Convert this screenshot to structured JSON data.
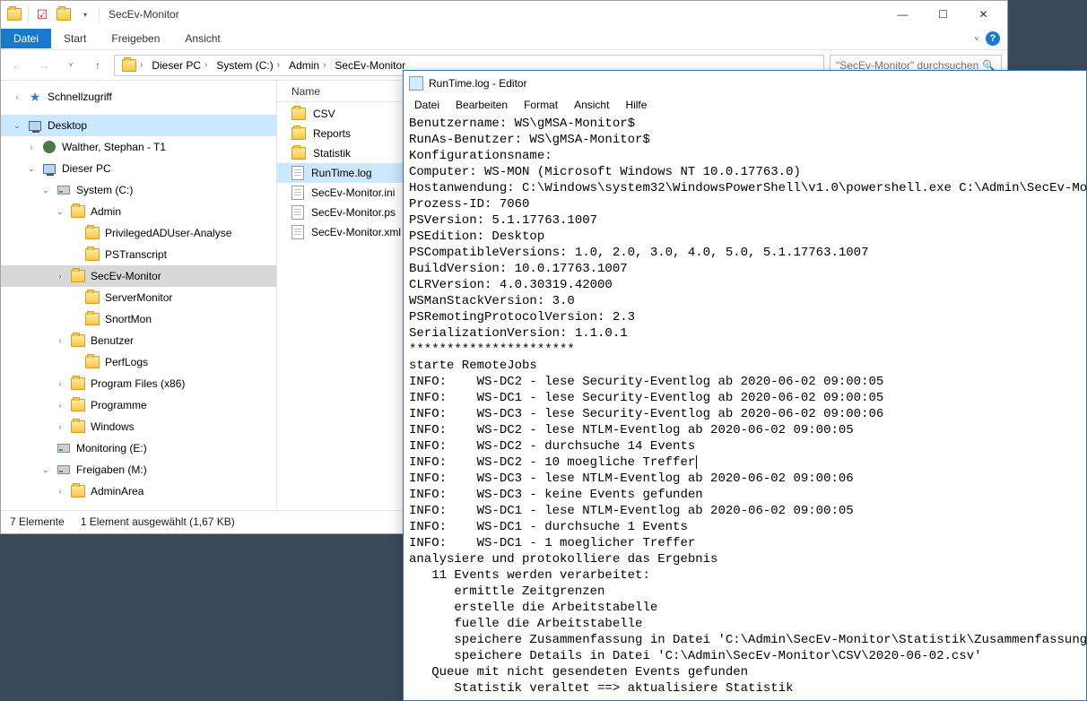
{
  "explorer": {
    "title": "SecEv-Monitor",
    "ribbon": {
      "file": "Datei",
      "start": "Start",
      "share": "Freigeben",
      "view": "Ansicht"
    },
    "breadcrumb": [
      "Dieser PC",
      "System (C:)",
      "Admin",
      "SecEv-Monitor"
    ],
    "search_placeholder": "\"SecEv-Monitor\" durchsuchen",
    "nav": {
      "quick": "Schnellzugriff",
      "desktop": "Desktop",
      "user": "Walther, Stephan - T1",
      "thispc": "Dieser PC",
      "system": "System (C:)",
      "admin": "Admin",
      "priv": "PrivilegedADUser-Analyse",
      "pstrans": "PSTranscript",
      "secev": "SecEv-Monitor",
      "servermon": "ServerMonitor",
      "snort": "SnortMon",
      "benutzer": "Benutzer",
      "perflogs": "PerfLogs",
      "progfiles": "Program Files (x86)",
      "programme": "Programme",
      "windows": "Windows",
      "monitoring": "Monitoring (E:)",
      "freigaben": "Freigaben (M:)",
      "adminarea": "AdminArea"
    },
    "list": {
      "header": "Name",
      "items": [
        "CSV",
        "Reports",
        "Statistik",
        "RunTime.log",
        "SecEv-Monitor.ini",
        "SecEv-Monitor.ps",
        "SecEv-Monitor.xml"
      ]
    },
    "status": {
      "count": "7 Elemente",
      "sel": "1 Element ausgewählt (1,67 KB)"
    }
  },
  "notepad": {
    "title": "RunTime.log - Editor",
    "menu": {
      "file": "Datei",
      "edit": "Bearbeiten",
      "format": "Format",
      "view": "Ansicht",
      "help": "Hilfe"
    },
    "lines": [
      "Benutzername: WS\\gMSA-Monitor$",
      "RunAs-Benutzer: WS\\gMSA-Monitor$",
      "Konfigurationsname:",
      "Computer: WS-MON (Microsoft Windows NT 10.0.17763.0)",
      "Hostanwendung: C:\\Windows\\system32\\WindowsPowerShell\\v1.0\\powershell.exe C:\\Admin\\SecEv-Monitor",
      "Prozess-ID: 7060",
      "PSVersion: 5.1.17763.1007",
      "PSEdition: Desktop",
      "PSCompatibleVersions: 1.0, 2.0, 3.0, 4.0, 5.0, 5.1.17763.1007",
      "BuildVersion: 10.0.17763.1007",
      "CLRVersion: 4.0.30319.42000",
      "WSManStackVersion: 3.0",
      "PSRemotingProtocolVersion: 2.3",
      "SerializationVersion: 1.1.0.1",
      "**********************",
      "starte RemoteJobs",
      "INFO:    WS-DC2 - lese Security-Eventlog ab 2020-06-02 09:00:05",
      "INFO:    WS-DC1 - lese Security-Eventlog ab 2020-06-02 09:00:05",
      "INFO:    WS-DC3 - lese Security-Eventlog ab 2020-06-02 09:00:06",
      "INFO:    WS-DC2 - lese NTLM-Eventlog ab 2020-06-02 09:00:05",
      "INFO:    WS-DC2 - durchsuche 14 Events",
      "INFO:    WS-DC2 - 10 moegliche Treffer",
      "INFO:    WS-DC3 - lese NTLM-Eventlog ab 2020-06-02 09:00:06",
      "INFO:    WS-DC3 - keine Events gefunden",
      "INFO:    WS-DC1 - lese NTLM-Eventlog ab 2020-06-02 09:00:05",
      "INFO:    WS-DC1 - durchsuche 1 Events",
      "INFO:    WS-DC1 - 1 moeglicher Treffer",
      "analysiere und protokolliere das Ergebnis",
      "   11 Events werden verarbeitet:",
      "      ermittle Zeitgrenzen",
      "      erstelle die Arbeitstabelle",
      "      fuelle die Arbeitstabelle",
      "      speichere Zusammenfassung in Datei 'C:\\Admin\\SecEv-Monitor\\Statistik\\Zusammenfassung.csv'",
      "      speichere Details in Datei 'C:\\Admin\\SecEv-Monitor\\CSV\\2020-06-02.csv'",
      "   Queue mit nicht gesendeten Events gefunden",
      "      Statistik veraltet ==> aktualisiere Statistik"
    ]
  }
}
